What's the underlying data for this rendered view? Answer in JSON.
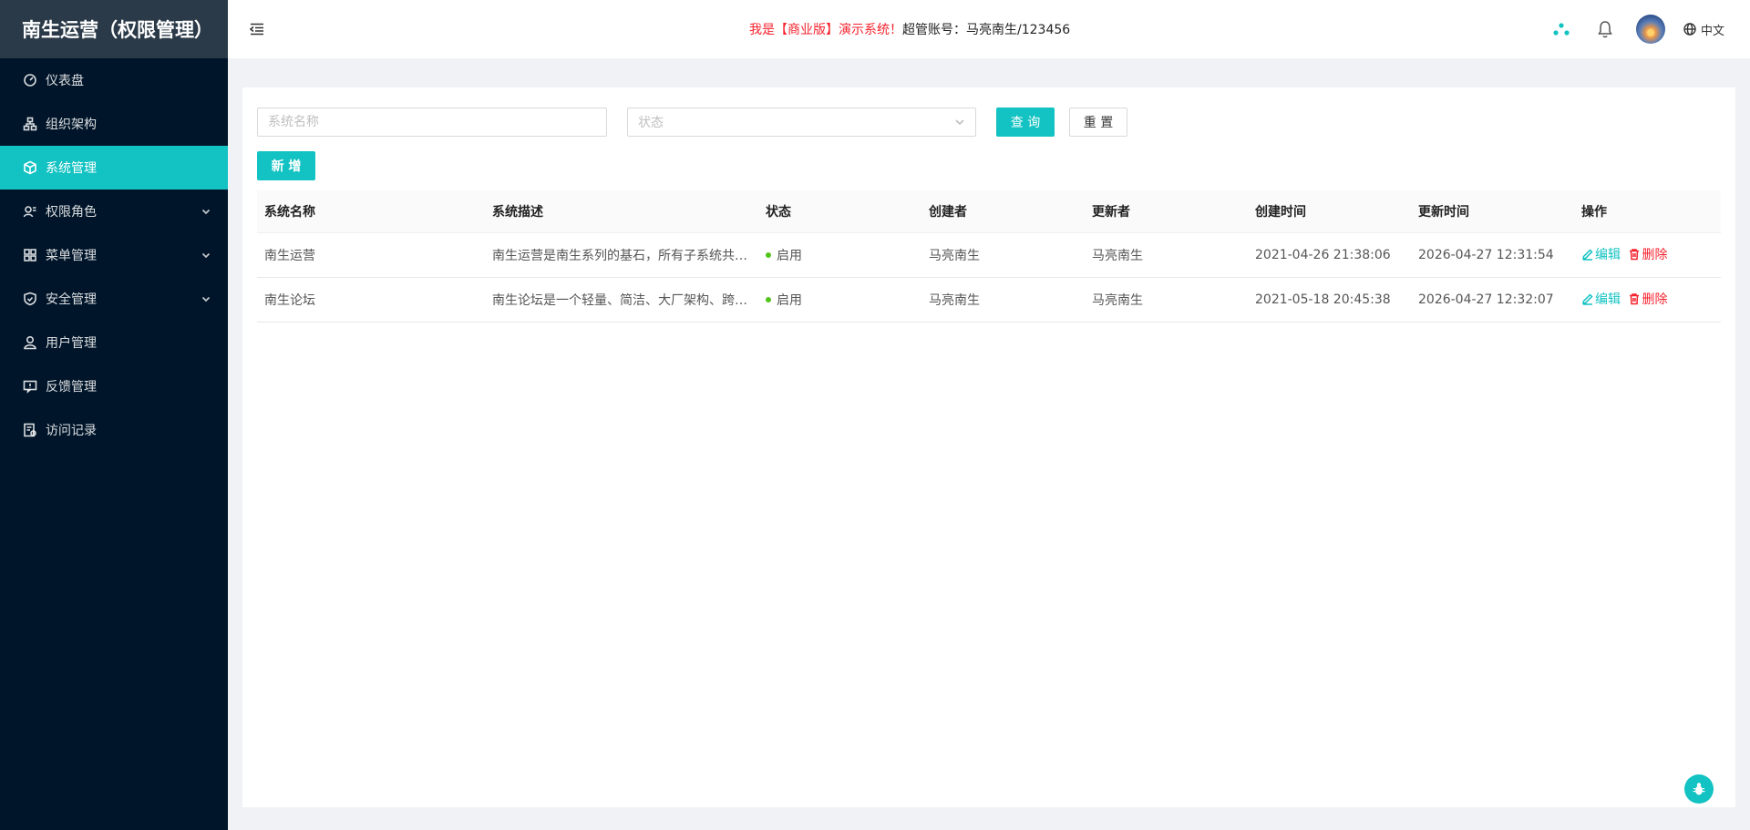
{
  "sidebar": {
    "logo": "南生运营（权限管理）",
    "items": [
      {
        "label": "仪表盘",
        "icon": "dashboard-icon"
      },
      {
        "label": "组织架构",
        "icon": "org-chart-icon"
      },
      {
        "label": "系统管理",
        "icon": "cube-icon",
        "active": true
      },
      {
        "label": "权限角色",
        "icon": "role-icon",
        "expandable": true
      },
      {
        "label": "菜单管理",
        "icon": "grid-icon",
        "expandable": true
      },
      {
        "label": "安全管理",
        "icon": "shield-icon",
        "expandable": true
      },
      {
        "label": "用户管理",
        "icon": "user-icon"
      },
      {
        "label": "反馈管理",
        "icon": "feedback-icon"
      },
      {
        "label": "访问记录",
        "icon": "record-icon"
      }
    ]
  },
  "header": {
    "notice_red": "我是【商业版】演示系统！",
    "notice_dark": "超管账号：马亮南生/123456",
    "lang": "中文"
  },
  "filters": {
    "name_placeholder": "系统名称",
    "status_placeholder": "状态",
    "query_label": "查 询",
    "reset_label": "重 置"
  },
  "add_label": "新 增",
  "table": {
    "columns": [
      "系统名称",
      "系统描述",
      "状态",
      "创建者",
      "更新者",
      "创建时间",
      "更新时间",
      "操作"
    ],
    "rows": [
      {
        "name": "南生运营",
        "desc": "南生运营是南生系列的基石，所有子系统共用一套权限",
        "status": "启用",
        "creator": "马亮南生",
        "updater": "马亮南生",
        "created": "2021-04-26 21:38:06",
        "updated": "2026-04-27 12:31:54",
        "edit": "编辑",
        "del": "删除"
      },
      {
        "name": "南生论坛",
        "desc": "南生论坛是一个轻量、简洁、大厂架构、跨平台的社区系统",
        "status": "启用",
        "creator": "马亮南生",
        "updater": "马亮南生",
        "created": "2021-05-18 20:45:38",
        "updated": "2026-04-27 12:32:07",
        "edit": "编辑",
        "del": "删除"
      }
    ]
  },
  "colors": {
    "accent": "#13c2c2",
    "sidebar_bg": "#001529",
    "danger": "#f5222d",
    "success": "#52c41a"
  }
}
